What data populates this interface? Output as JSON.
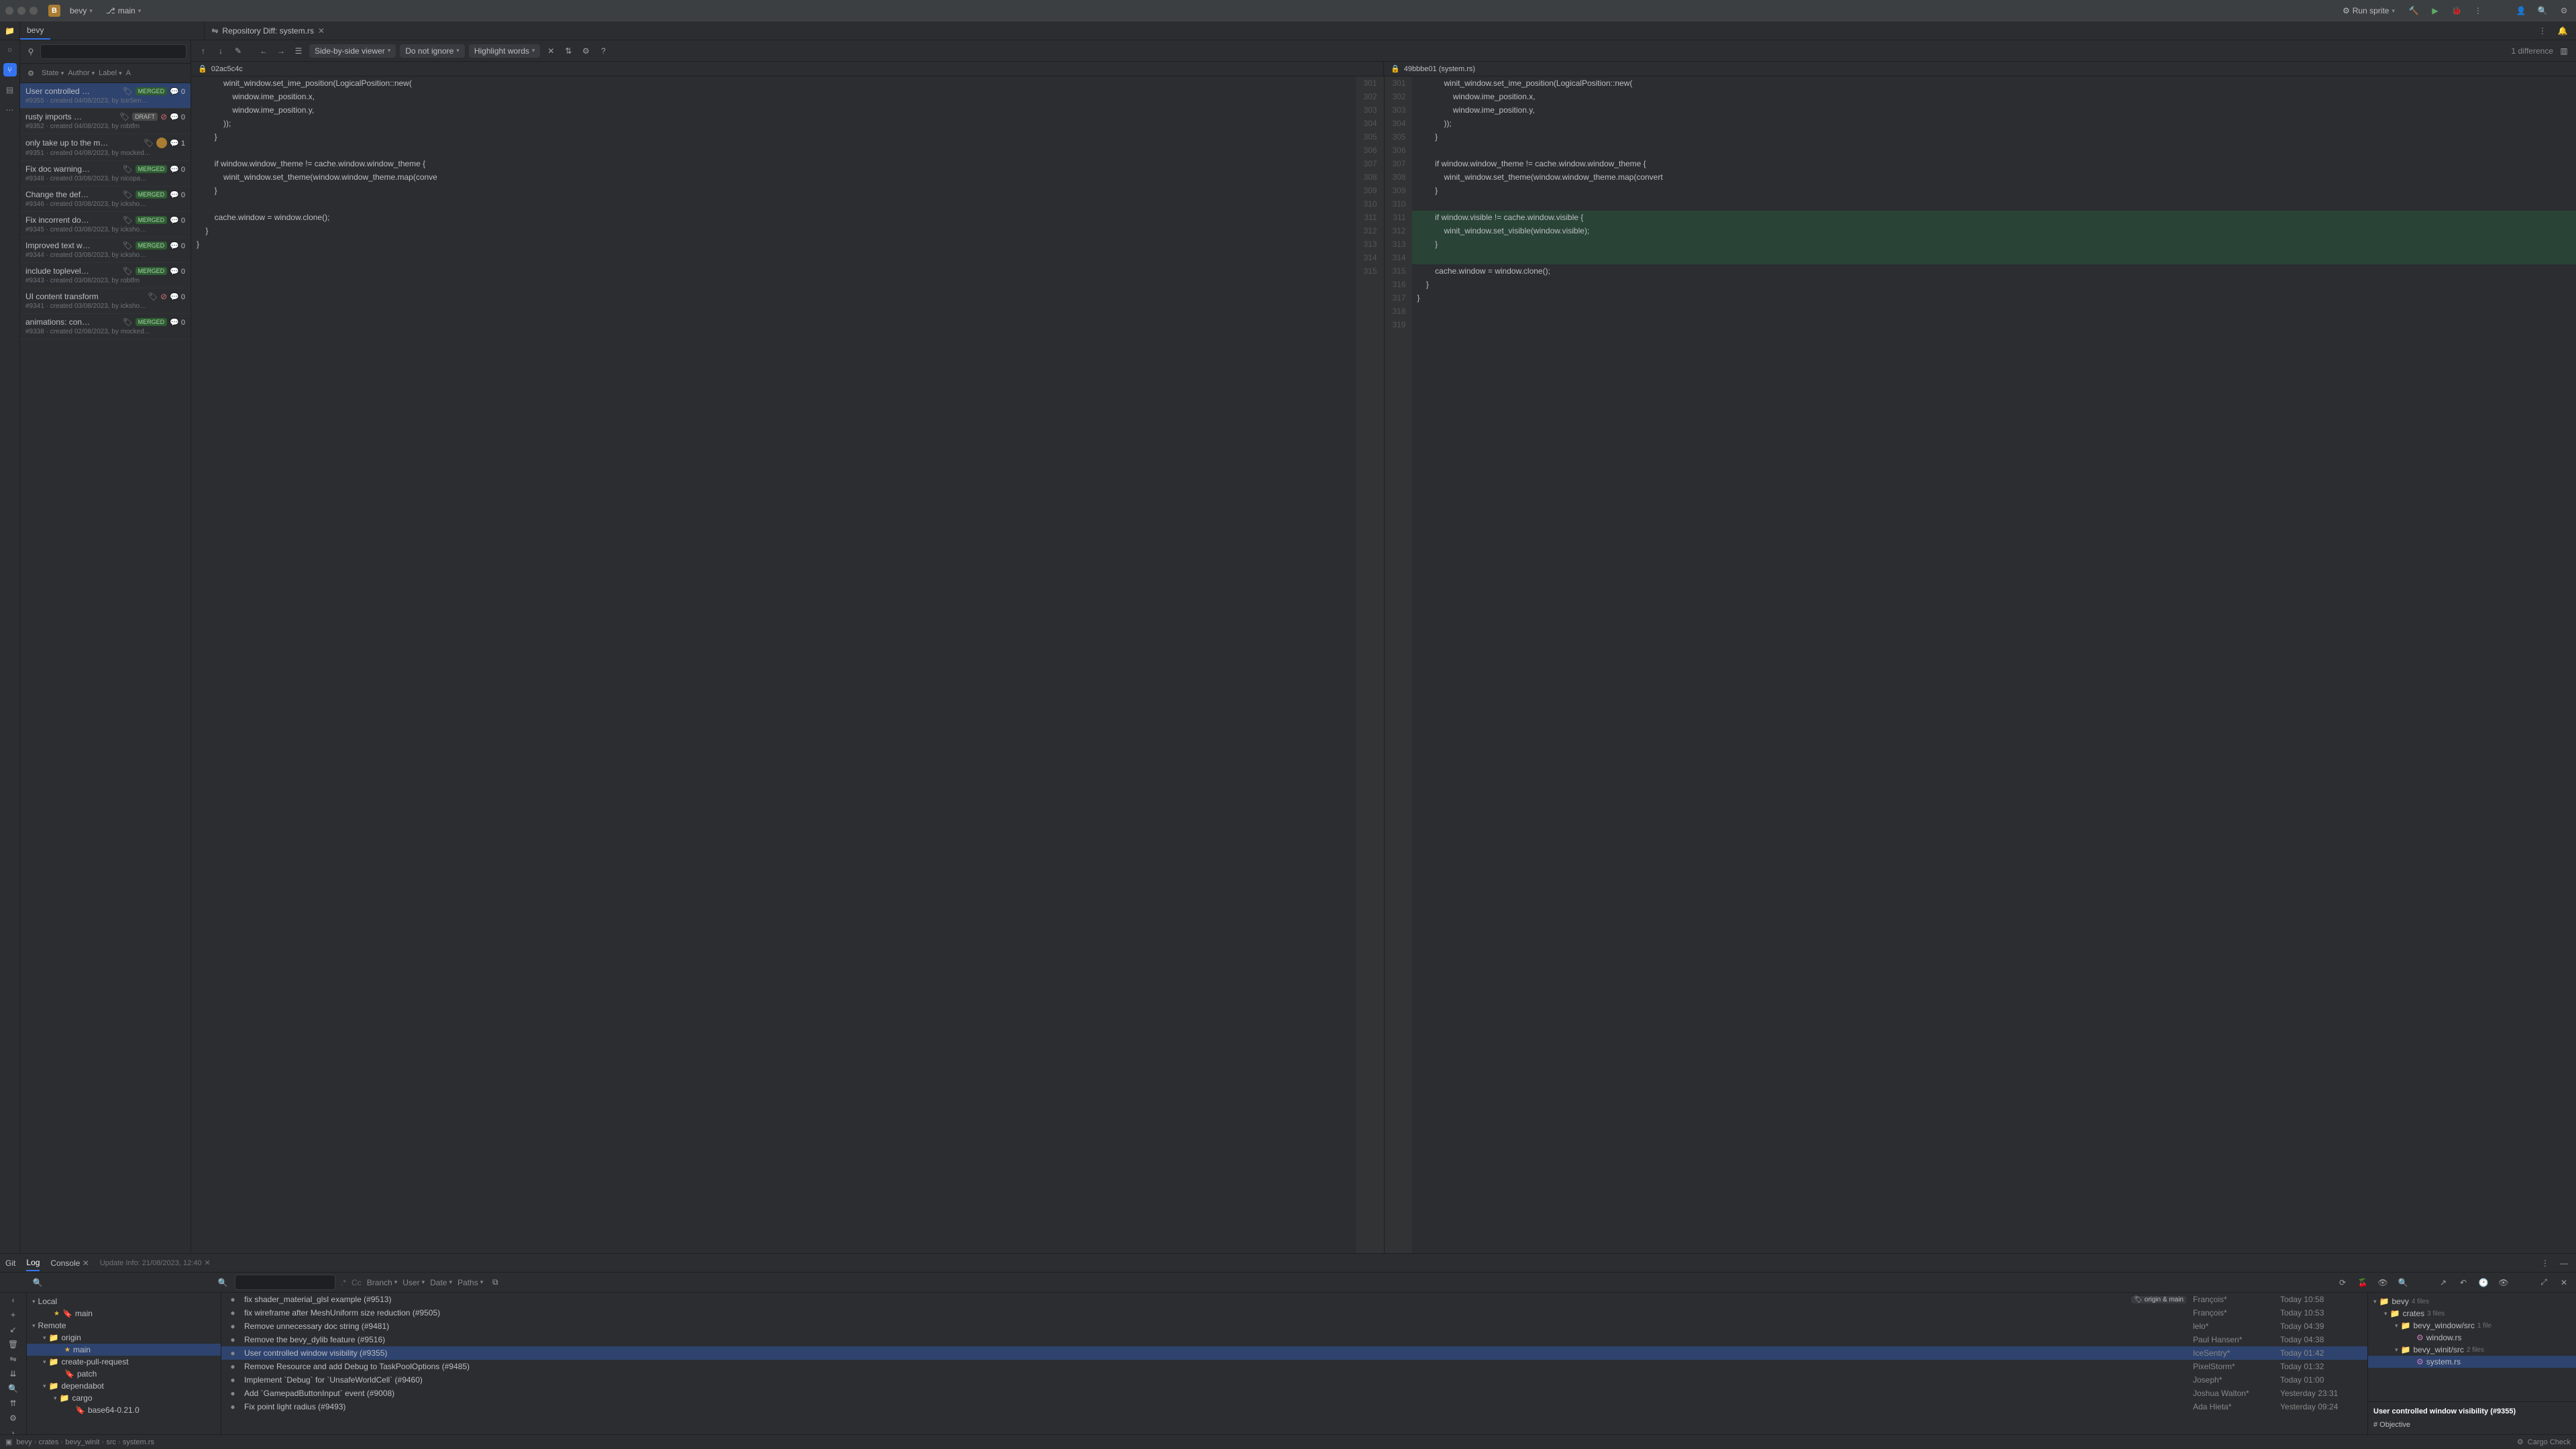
{
  "titlebar": {
    "project": "bevy",
    "project_badge": "B",
    "branch": "main",
    "run_config": "Run sprite"
  },
  "project_tab": "bevy",
  "editor_tab": {
    "label": "Repository Diff: system.rs"
  },
  "diff_toolbar": {
    "viewer_mode": "Side-by-side viewer",
    "ignore": "Do not ignore",
    "highlight": "Highlight words",
    "count": "1 difference"
  },
  "diff_header": {
    "left": "02ac5c4c",
    "right": "49bbbe01 (system.rs)"
  },
  "pr_filters": {
    "state": "State",
    "author": "Author",
    "label": "Label",
    "assignee": "A"
  },
  "pull_requests": [
    {
      "title": "User controlled …",
      "badge": "MERGED",
      "comments": "0",
      "meta": "#9355 · created 04/08/2023, by IceSen…",
      "selected": true
    },
    {
      "title": "rusty imports …",
      "badge": "DRAFT",
      "fail": true,
      "comments": "0",
      "meta": "#9352 · created 04/08/2023, by robtfm"
    },
    {
      "title": "only take up to the m…",
      "avatar": true,
      "comments": "1",
      "meta": "#9351 · created 04/08/2023, by mocked…"
    },
    {
      "title": "Fix doc warning…",
      "badge": "MERGED",
      "comments": "0",
      "meta": "#9348 · created 03/08/2023, by nicopa…"
    },
    {
      "title": "Change the def…",
      "badge": "MERGED",
      "comments": "0",
      "meta": "#9346 · created 03/08/2023, by icksho…"
    },
    {
      "title": "Fix incorrent do…",
      "badge": "MERGED",
      "comments": "0",
      "meta": "#9345 · created 03/08/2023, by icksho…"
    },
    {
      "title": "Improved text w…",
      "badge": "MERGED",
      "comments": "0",
      "meta": "#9344 · created 03/08/2023, by icksho…"
    },
    {
      "title": "include toplevel…",
      "badge": "MERGED",
      "comments": "0",
      "meta": "#9343 · created 03/08/2023, by robtfm"
    },
    {
      "title": "UI content transform",
      "fail": true,
      "comments": "0",
      "meta": "#9341 · created 03/08/2023, by icksho…"
    },
    {
      "title": "animations: con…",
      "badge": "MERGED",
      "comments": "0",
      "meta": "#9338 · created 02/08/2023, by mocked…"
    }
  ],
  "diff_left": [
    {
      "ln": "",
      "code": "            winit_window.set_ime_position(LogicalPosition::new("
    },
    {
      "ln": "",
      "code": "                window.ime_position.x,"
    },
    {
      "ln": "",
      "code": "                window.ime_position.y,"
    },
    {
      "ln": "",
      "code": "            ));"
    },
    {
      "ln": "",
      "code": "        }"
    },
    {
      "ln": "",
      "code": ""
    },
    {
      "ln": "",
      "code": "        if window.window_theme != cache.window.window_theme {"
    },
    {
      "ln": "",
      "code": "            winit_window.set_theme(window.window_theme.map(conve"
    },
    {
      "ln": "",
      "code": "        }"
    },
    {
      "ln": "",
      "code": ""
    },
    {
      "ln": "",
      "code": "        cache.window = window.clone();"
    },
    {
      "ln": "",
      "code": "    }"
    },
    {
      "ln": "",
      "code": "}"
    }
  ],
  "diff_left_ln": [
    "301",
    "302",
    "303",
    "304",
    "305",
    "306",
    "307",
    "308",
    "309",
    "310",
    "311",
    "312",
    "313",
    "314",
    "315"
  ],
  "diff_right_ln": [
    "301",
    "302",
    "303",
    "304",
    "305",
    "306",
    "307",
    "308",
    "309",
    "310",
    "311",
    "312",
    "313",
    "314",
    "315",
    "316",
    "317",
    "318",
    "319"
  ],
  "diff_right": [
    {
      "code": "            winit_window.set_ime_position(LogicalPosition::new("
    },
    {
      "code": "                window.ime_position.x,"
    },
    {
      "code": "                window.ime_position.y,"
    },
    {
      "code": "            ));"
    },
    {
      "code": "        }"
    },
    {
      "code": ""
    },
    {
      "code": "        if window.window_theme != cache.window.window_theme {"
    },
    {
      "code": "            winit_window.set_theme(window.window_theme.map(convert"
    },
    {
      "code": "        }"
    },
    {
      "code": ""
    },
    {
      "code": "        if window.visible != cache.window.visible {",
      "add": true
    },
    {
      "code": "            winit_window.set_visible(window.visible);",
      "add": true
    },
    {
      "code": "        }",
      "add": true
    },
    {
      "code": "",
      "add": true
    },
    {
      "code": "        cache.window = window.clone();"
    },
    {
      "code": "    }"
    },
    {
      "code": "}"
    },
    {
      "code": ""
    },
    {
      "code": ""
    }
  ],
  "bottom": {
    "tabs": {
      "git": "Git",
      "log": "Log",
      "console": "Console"
    },
    "update_info": "Update Info: 21/08/2023, 12:40",
    "filters": {
      "branch": "Branch",
      "user": "User",
      "date": "Date",
      "paths": "Paths"
    },
    "regex": ".*",
    "cc": "Cc"
  },
  "branch_tree": [
    {
      "depth": 0,
      "exp": "▾",
      "label": "Local"
    },
    {
      "depth": 1,
      "icon": "tag",
      "label": "main",
      "star": true
    },
    {
      "depth": 0,
      "exp": "▾",
      "label": "Remote"
    },
    {
      "depth": 1,
      "exp": "▾",
      "icon": "dir",
      "label": "origin"
    },
    {
      "depth": 2,
      "label": "main",
      "star": true,
      "sel": true
    },
    {
      "depth": 1,
      "exp": "▾",
      "icon": "dir",
      "label": "create-pull-request"
    },
    {
      "depth": 2,
      "icon": "tag",
      "label": "patch"
    },
    {
      "depth": 1,
      "exp": "▾",
      "icon": "dir",
      "label": "dependabot"
    },
    {
      "depth": 2,
      "exp": "▾",
      "icon": "dir",
      "label": "cargo"
    },
    {
      "depth": 3,
      "icon": "tag",
      "label": "base64-0.21.0"
    }
  ],
  "commits": [
    {
      "msg": "fix shader_material_glsl example (#9513)",
      "tags": [
        "origin & main"
      ],
      "author": "François*",
      "date": "Today 10:58"
    },
    {
      "msg": "fix wireframe after MeshUniform size reduction (#9505)",
      "author": "François*",
      "date": "Today 10:53"
    },
    {
      "msg": "Remove unnecessary doc string (#9481)",
      "author": "lelo*",
      "date": "Today 04:39"
    },
    {
      "msg": "Remove the bevy_dylib feature (#9516)",
      "author": "Paul Hansen*",
      "date": "Today 04:38"
    },
    {
      "msg": "User controlled window visibility (#9355)",
      "author": "IceSentry*",
      "date": "Today 01:42",
      "sel": true
    },
    {
      "msg": "Remove Resource and add Debug to TaskPoolOptions (#9485)",
      "author": "PixelStorm*",
      "date": "Today 01:32"
    },
    {
      "msg": "Implement `Debug` for `UnsafeWorldCell` (#9460)",
      "author": "Joseph*",
      "date": "Today 01:00"
    },
    {
      "msg": "Add `GamepadButtonInput` event (#9008)",
      "author": "Joshua Walton*",
      "date": "Yesterday 23:31"
    },
    {
      "msg": "Fix point light radius (#9493)",
      "author": "Ada Hieta*",
      "date": "Yesterday 09:24"
    }
  ],
  "commit_files": {
    "root": "bevy",
    "root_cnt": "4 files",
    "nodes": [
      {
        "depth": 1,
        "exp": "▾",
        "icon": "dir",
        "label": "crates",
        "cnt": "3 files"
      },
      {
        "depth": 2,
        "exp": "▾",
        "icon": "dir",
        "label": "bevy_window/src",
        "cnt": "1 file"
      },
      {
        "depth": 3,
        "icon": "rs",
        "label": "window.rs"
      },
      {
        "depth": 2,
        "exp": "▾",
        "icon": "dir",
        "label": "bevy_winit/src",
        "cnt": "2 files"
      },
      {
        "depth": 3,
        "icon": "rs",
        "label": "system.rs",
        "sel": true
      }
    ]
  },
  "commit_detail": {
    "title": "User controlled window visibility (#9355)",
    "section": "# Objective"
  },
  "statusbar": {
    "crumbs": [
      "bevy",
      "crates",
      "bevy_winit",
      "src",
      "system.rs"
    ],
    "cargo": "Cargo Check"
  }
}
